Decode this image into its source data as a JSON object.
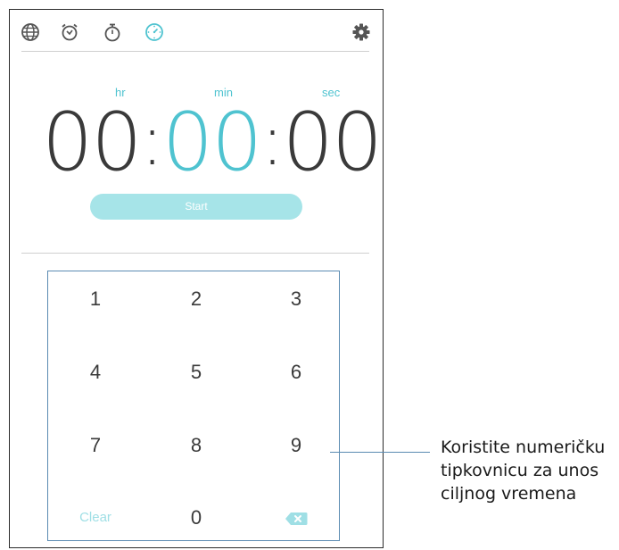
{
  "tabs": [
    {
      "id": "world-clock",
      "icon": "globe-icon"
    },
    {
      "id": "alarm",
      "icon": "alarm-clock-icon"
    },
    {
      "id": "stopwatch",
      "icon": "stopwatch-icon"
    },
    {
      "id": "timer",
      "icon": "timer-icon",
      "active": true
    }
  ],
  "settings_icon": "gear-icon",
  "units": {
    "hr": "hr",
    "min": "min",
    "sec": "sec"
  },
  "time": {
    "hours": "00",
    "colon1": ":",
    "minutes": "00",
    "colon2": ":",
    "seconds": "00"
  },
  "start_label": "Start",
  "keypad": {
    "keys": [
      "1",
      "2",
      "3",
      "4",
      "5",
      "6",
      "7",
      "8",
      "9"
    ],
    "clear_label": "Clear",
    "zero_label": "0",
    "backspace_icon": "backspace-icon"
  },
  "callout": {
    "line1": "Koristite numeričku",
    "line2": "tipkovnicu za unos",
    "line3": "ciljnog vremena"
  },
  "colors": {
    "accent": "#4fc3d0",
    "start_button": "#a6e4e8",
    "callout_line": "#5b8bb2"
  }
}
